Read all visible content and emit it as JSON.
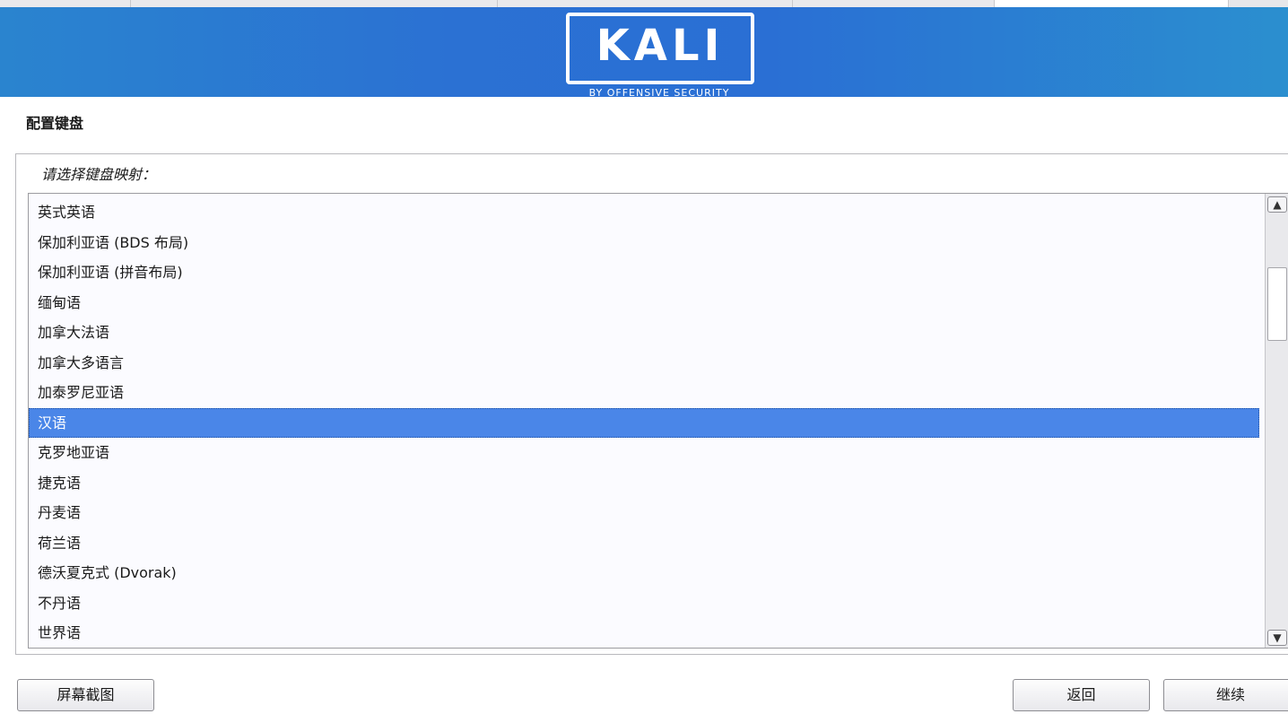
{
  "banner": {
    "logo_word": "KALI",
    "logo_tagline": "BY OFFENSIVE SECURITY"
  },
  "page": {
    "title": "配置键盘",
    "prompt": "请选择键盘映射："
  },
  "keymap_list": {
    "items": [
      "英式英语",
      "保加利亚语 (BDS 布局)",
      "保加利亚语 (拼音布局)",
      "缅甸语",
      "加拿大法语",
      "加拿大多语言",
      "加泰罗尼亚语",
      "汉语",
      "克罗地亚语",
      "捷克语",
      "丹麦语",
      "荷兰语",
      "德沃夏克式 (Dvorak)",
      "不丹语",
      "世界语"
    ],
    "selected": "汉语"
  },
  "buttons": {
    "screenshot": "屏幕截图",
    "back": "返回",
    "continue": "继续"
  },
  "icons": {
    "scroll_up": "chevron-up-icon",
    "scroll_down": "chevron-down-icon"
  },
  "colors": {
    "banner_blue": "#2b71d3",
    "selection": "#4a86e8"
  }
}
